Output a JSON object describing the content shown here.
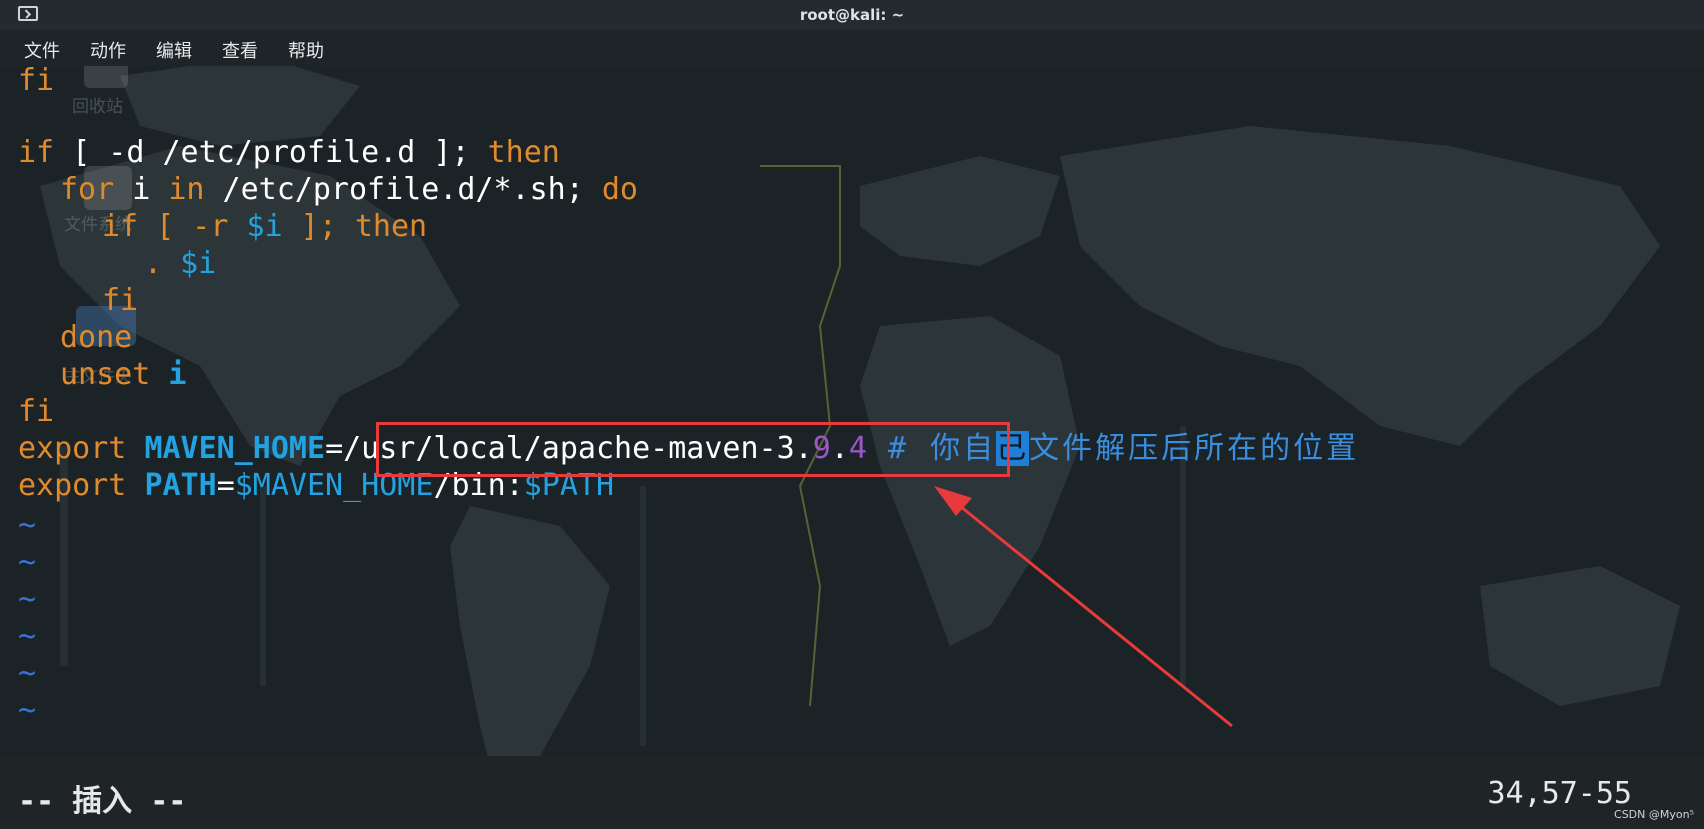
{
  "window": {
    "title": "root@kali: ~"
  },
  "menu": [
    "文件",
    "动作",
    "编辑",
    "查看",
    "帮助"
  ],
  "desktop_ghosts": {
    "trash": "回收站",
    "filesystem": "文件系统",
    "home": "主文件夹"
  },
  "editor": {
    "line1": {
      "kw": "fi"
    },
    "line3": {
      "kw_if": "if",
      "open": " [ -d /etc/profile.d ]; ",
      "kw_then": "then"
    },
    "line4": {
      "kw_for": "for",
      "mid1": " i ",
      "kw_in": "in",
      "mid2": " /etc/profile.d/*.sh; ",
      "kw_do": "do"
    },
    "line5": {
      "kw_if": "if",
      "open": " [ -r ",
      "var": "$i",
      "close": " ]; ",
      "kw_then": "then"
    },
    "line6": {
      "dot": ". ",
      "var": "$i"
    },
    "line7": {
      "kw": "fi"
    },
    "line8": {
      "kw": "done"
    },
    "line9": {
      "kw": "unset",
      "space": " ",
      "id": "i"
    },
    "line10": {
      "kw": "fi"
    },
    "line11": {
      "kw": "export",
      "space": " ",
      "id": "MAVEN_HOME",
      "eq_path": "=/usr/local/apache-maven-3.",
      "num1": "9",
      "dot": ".",
      "num2": "4",
      "comment_pre": " # 你自",
      "comment_hl": "己",
      "comment_post": "文件解压后所在的位置"
    },
    "line12": {
      "kw": "export",
      "space": " ",
      "id": "PATH",
      "eq": "=",
      "var1": "$MAVEN_HOME",
      "mid": "/bin:",
      "var2": "$PATH"
    },
    "tilde": "~"
  },
  "status": {
    "mode": "-- 插入 --",
    "position": "34,57-55"
  },
  "watermark": "CSDN @Myon⁵",
  "colors": {
    "keyword": "#e08a2c",
    "identifier": "#22a2e0",
    "number": "#9b57c8",
    "annotation": "#e83a3a"
  }
}
